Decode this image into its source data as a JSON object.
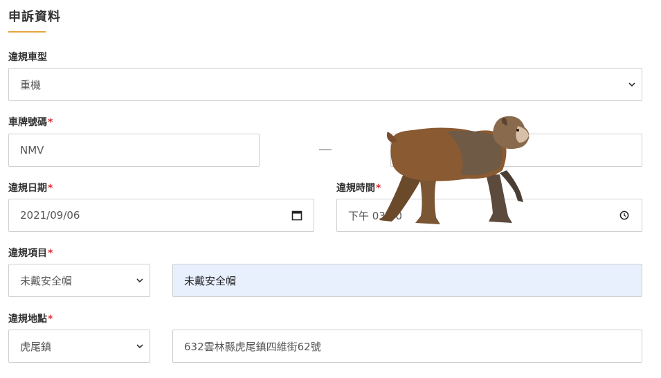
{
  "section": {
    "title": "申訴資料"
  },
  "vehicle_type": {
    "label": "違規車型",
    "value": "重機"
  },
  "plate": {
    "label": "車牌號碼",
    "required_mark": "*",
    "prefix": "NMV",
    "suffix": ""
  },
  "date": {
    "label": "違規日期",
    "required_mark": "*",
    "value": "2021/09/06"
  },
  "time": {
    "label": "違規時間",
    "required_mark": "*",
    "value": "下午 03:30"
  },
  "item": {
    "label": "違規項目",
    "required_mark": "*",
    "select_value": "未戴安全帽",
    "detail": "未戴安全帽"
  },
  "location": {
    "label": "違規地點",
    "required_mark": "*",
    "select_value": "虎尾鎮",
    "address": "632雲林縣虎尾鎮四維街62號"
  },
  "icons": {
    "dropdown": "chevron-down-icon",
    "calendar": "calendar-icon",
    "clock": "clock-icon"
  },
  "colors": {
    "accent": "#e8a33c",
    "required": "#e0303a",
    "highlight_bg": "#e8effd"
  }
}
